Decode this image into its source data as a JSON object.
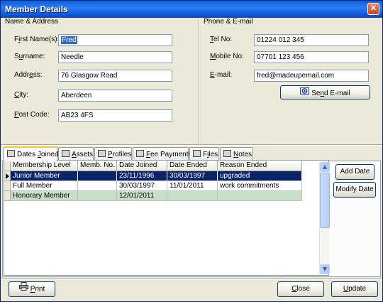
{
  "window": {
    "title": "Member Details",
    "close_symbol": "✕"
  },
  "name_address": {
    "group_label": "Name & Address",
    "fields": [
      {
        "label_pre": "F",
        "label_ul": "i",
        "label_post": "rst Name(s):",
        "value": "Fred",
        "selected": true
      },
      {
        "label_pre": "S",
        "label_ul": "u",
        "label_post": "rname:",
        "value": "Needle"
      },
      {
        "label_pre": "Addr",
        "label_ul": "e",
        "label_post": "ss:",
        "value": "76 Glasgow Road"
      },
      {
        "label_pre": "",
        "label_ul": "C",
        "label_post": "ity:",
        "value": "Aberdeen"
      },
      {
        "label_pre": "",
        "label_ul": "P",
        "label_post": "ost Code:",
        "value": "AB23 4FS"
      }
    ]
  },
  "phone_email": {
    "group_label": "Phone & E-mail",
    "fields": [
      {
        "label_pre": "",
        "label_ul": "T",
        "label_post": "el No:",
        "value": "01224 012 345"
      },
      {
        "label_pre": "",
        "label_ul": "M",
        "label_post": "obile No:",
        "value": "07701 123 456"
      },
      {
        "label_pre": "",
        "label_ul": "E",
        "label_post": "-mail:",
        "value": "fred@madeupemail.com"
      }
    ],
    "send_email_pre": "Se",
    "send_email_ul": "n",
    "send_email_post": "d E-mail"
  },
  "tabs": [
    {
      "pre": "Dates ",
      "ul": "J",
      "post": "oined",
      "active": true,
      "icon": "calendar-icon"
    },
    {
      "pre": "",
      "ul": "A",
      "post": "ssets",
      "active": false,
      "icon": "assets-icon"
    },
    {
      "pre": "",
      "ul": "P",
      "post": "rofiles",
      "active": false,
      "icon": "profiles-icon"
    },
    {
      "pre": "",
      "ul": "F",
      "post": "ee Payments",
      "active": false,
      "icon": "money-icon"
    },
    {
      "pre": "F",
      "ul": "i",
      "post": "les",
      "active": false,
      "icon": "files-icon"
    },
    {
      "pre": "",
      "ul": "N",
      "post": "otes",
      "active": false,
      "icon": "notes-icon"
    }
  ],
  "grid": {
    "columns": [
      "Membership Level",
      "Memb. No.",
      "Date Joined",
      "Date Ended",
      "Reason Ended"
    ],
    "rows": [
      {
        "cells": [
          "Junior Member",
          "",
          "23/11/1996",
          "30/03/1997",
          "upgraded"
        ],
        "state": "selected"
      },
      {
        "cells": [
          "Full Member",
          "",
          "30/03/1997",
          "11/01/2011",
          "work commitments"
        ],
        "state": "normal"
      },
      {
        "cells": [
          "Honorary Member",
          "",
          "12/01/2011",
          "",
          ""
        ],
        "state": "green"
      }
    ]
  },
  "side_buttons": {
    "add_date": "Add Date",
    "modify_date": "Modify Date"
  },
  "footer": {
    "print_ul": "P",
    "print_post": "rint",
    "close_ul": "C",
    "close_post": "lose",
    "update_ul": "U",
    "update_post": "pdate"
  }
}
